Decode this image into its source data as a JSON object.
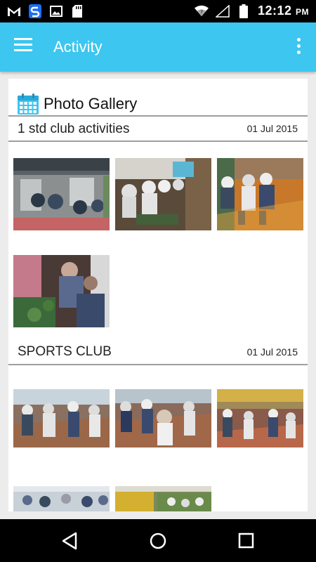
{
  "status_bar": {
    "time": "12:12",
    "ampm": "PM",
    "icons": [
      "gmail-icon",
      "sync-icon",
      "image-icon",
      "sd-card-icon",
      "wifi-icon",
      "cellular-signal-icon",
      "battery-icon"
    ]
  },
  "app_bar": {
    "title": "Activity",
    "icons": [
      "menu-icon",
      "more-vert-icon"
    ],
    "color": "#3cc6f0"
  },
  "gallery": {
    "title": "Photo Gallery",
    "icon": "calendar-icon",
    "sections": [
      {
        "name": "1 std club activities",
        "date": "01 Jul 2015",
        "photo_count": 4
      },
      {
        "name": "SPORTS CLUB",
        "date": "01 Jul 2015",
        "photo_count": 5
      }
    ]
  },
  "nav_bar": {
    "icons": [
      "back-icon",
      "home-icon",
      "recents-icon"
    ]
  }
}
